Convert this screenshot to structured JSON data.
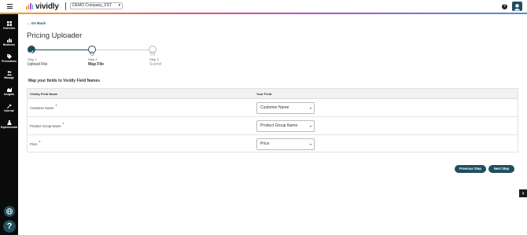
{
  "header": {
    "logo_text": "vividly",
    "company": "DEMO Company_FST",
    "brand_colors": [
      "#f5a623",
      "#e94e77",
      "#a259d9",
      "#4a90e2"
    ]
  },
  "sidebar": {
    "items": [
      {
        "label": "Overview",
        "icon": "grid-icon"
      },
      {
        "label": "Business",
        "icon": "bar-chart-icon"
      },
      {
        "label": "Promotions",
        "icon": "tag-icon"
      },
      {
        "label": "Manage",
        "icon": "users-icon"
      },
      {
        "label": "Insights",
        "icon": "chart-icon"
      },
      {
        "label": "Internal",
        "icon": "wrench-icon"
      },
      {
        "label": "Experimental",
        "icon": "flask-icon"
      }
    ],
    "help_label": "?"
  },
  "main": {
    "back_label": "Go Back",
    "title": "Pricing Uploader",
    "steps": [
      {
        "small": "Step 1",
        "name": "Upload File",
        "status": "complete"
      },
      {
        "small": "Step 2",
        "name": "Map File",
        "status": "active"
      },
      {
        "small": "Step 3",
        "name": "Submit",
        "status": "pending"
      }
    ],
    "section_label": "Map your fields to Vividly Field Names",
    "table": {
      "headers": [
        "Vividly Field Name",
        "Your Field"
      ],
      "rows": [
        {
          "field": "Customer Name",
          "required": "*",
          "value": "Customer Name"
        },
        {
          "field": "Product Group Name",
          "required": "*",
          "value": "Product Group Name"
        },
        {
          "field": "Price",
          "required": "*",
          "value": "Price"
        }
      ]
    },
    "buttons": {
      "previous": "Previous Step",
      "next": "Next Step"
    }
  },
  "colors": {
    "accent": "#1f4e5f",
    "sidebar_bg": "#0b0b0b",
    "required": "#d0021b"
  }
}
